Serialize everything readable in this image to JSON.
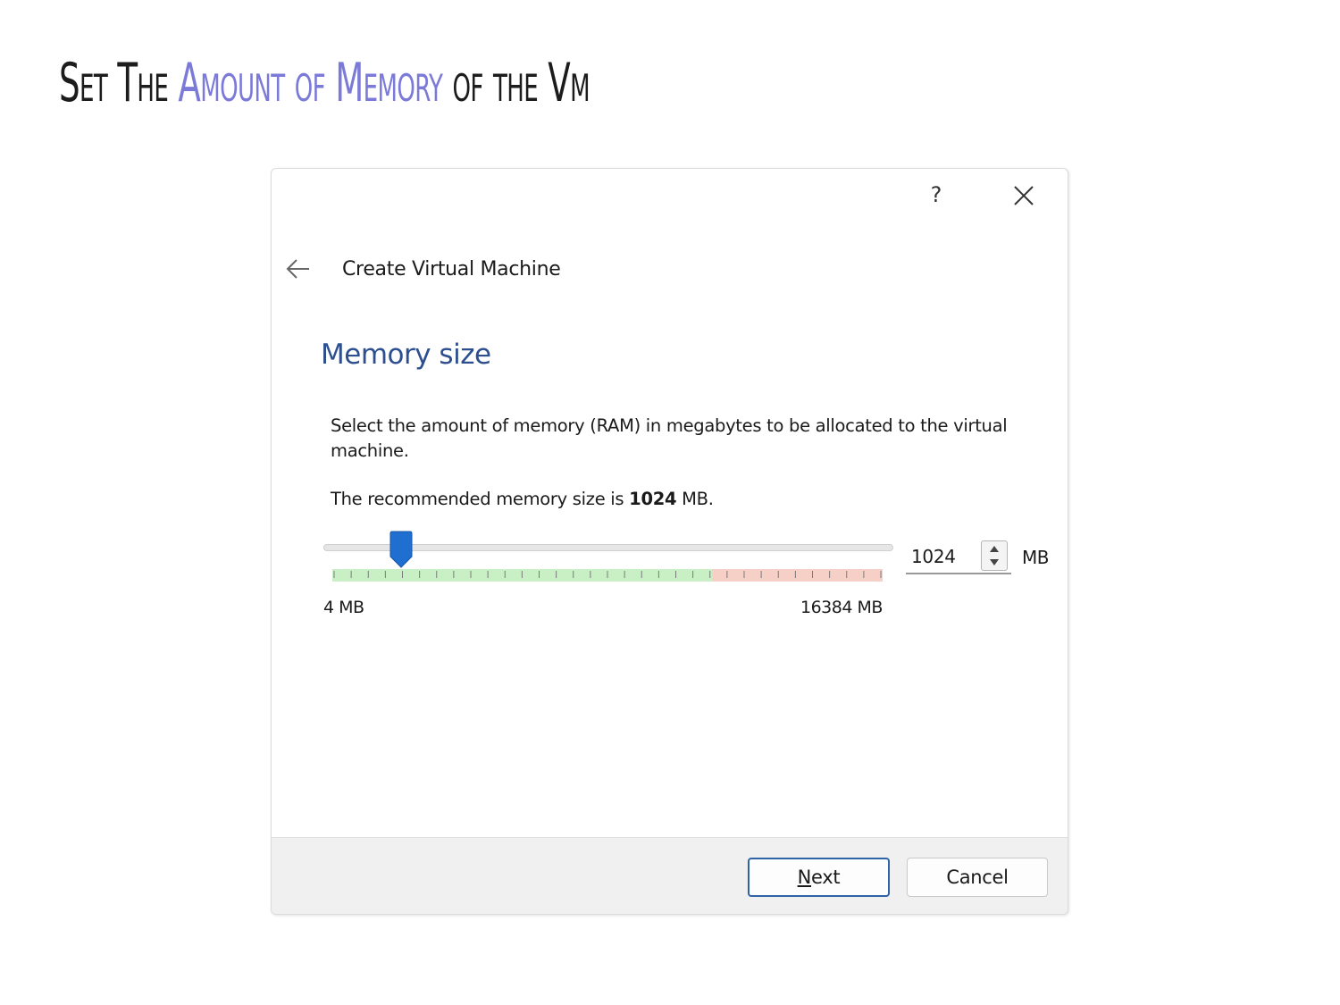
{
  "slide": {
    "title_part1": "Set The ",
    "title_accent": "Amount of Memory",
    "title_part2": " of the Vm",
    "accent_color": "#7c7ad8"
  },
  "dialog": {
    "help_label": "?",
    "close_icon": "close-icon",
    "back_icon": "arrow-left-icon",
    "wizard_title": "Create Virtual Machine",
    "section_title": "Memory size",
    "description": "Select the amount of memory (RAM) in megabytes to be allocated to the virtual machine.",
    "recommend_prefix": "The recommended memory size is ",
    "recommend_value": "1024",
    "recommend_suffix": " MB.",
    "slider": {
      "min_label": "4 MB",
      "max_label": "16384 MB",
      "min_value": 4,
      "max_value": 16384,
      "current_value": 1024,
      "safe_color": "#c9f0c4",
      "warn_color": "#f6d0c6"
    },
    "spinbox": {
      "value": "1024",
      "unit": "MB"
    },
    "buttons": {
      "next_first": "N",
      "next_rest": "ext",
      "cancel": "Cancel"
    }
  }
}
